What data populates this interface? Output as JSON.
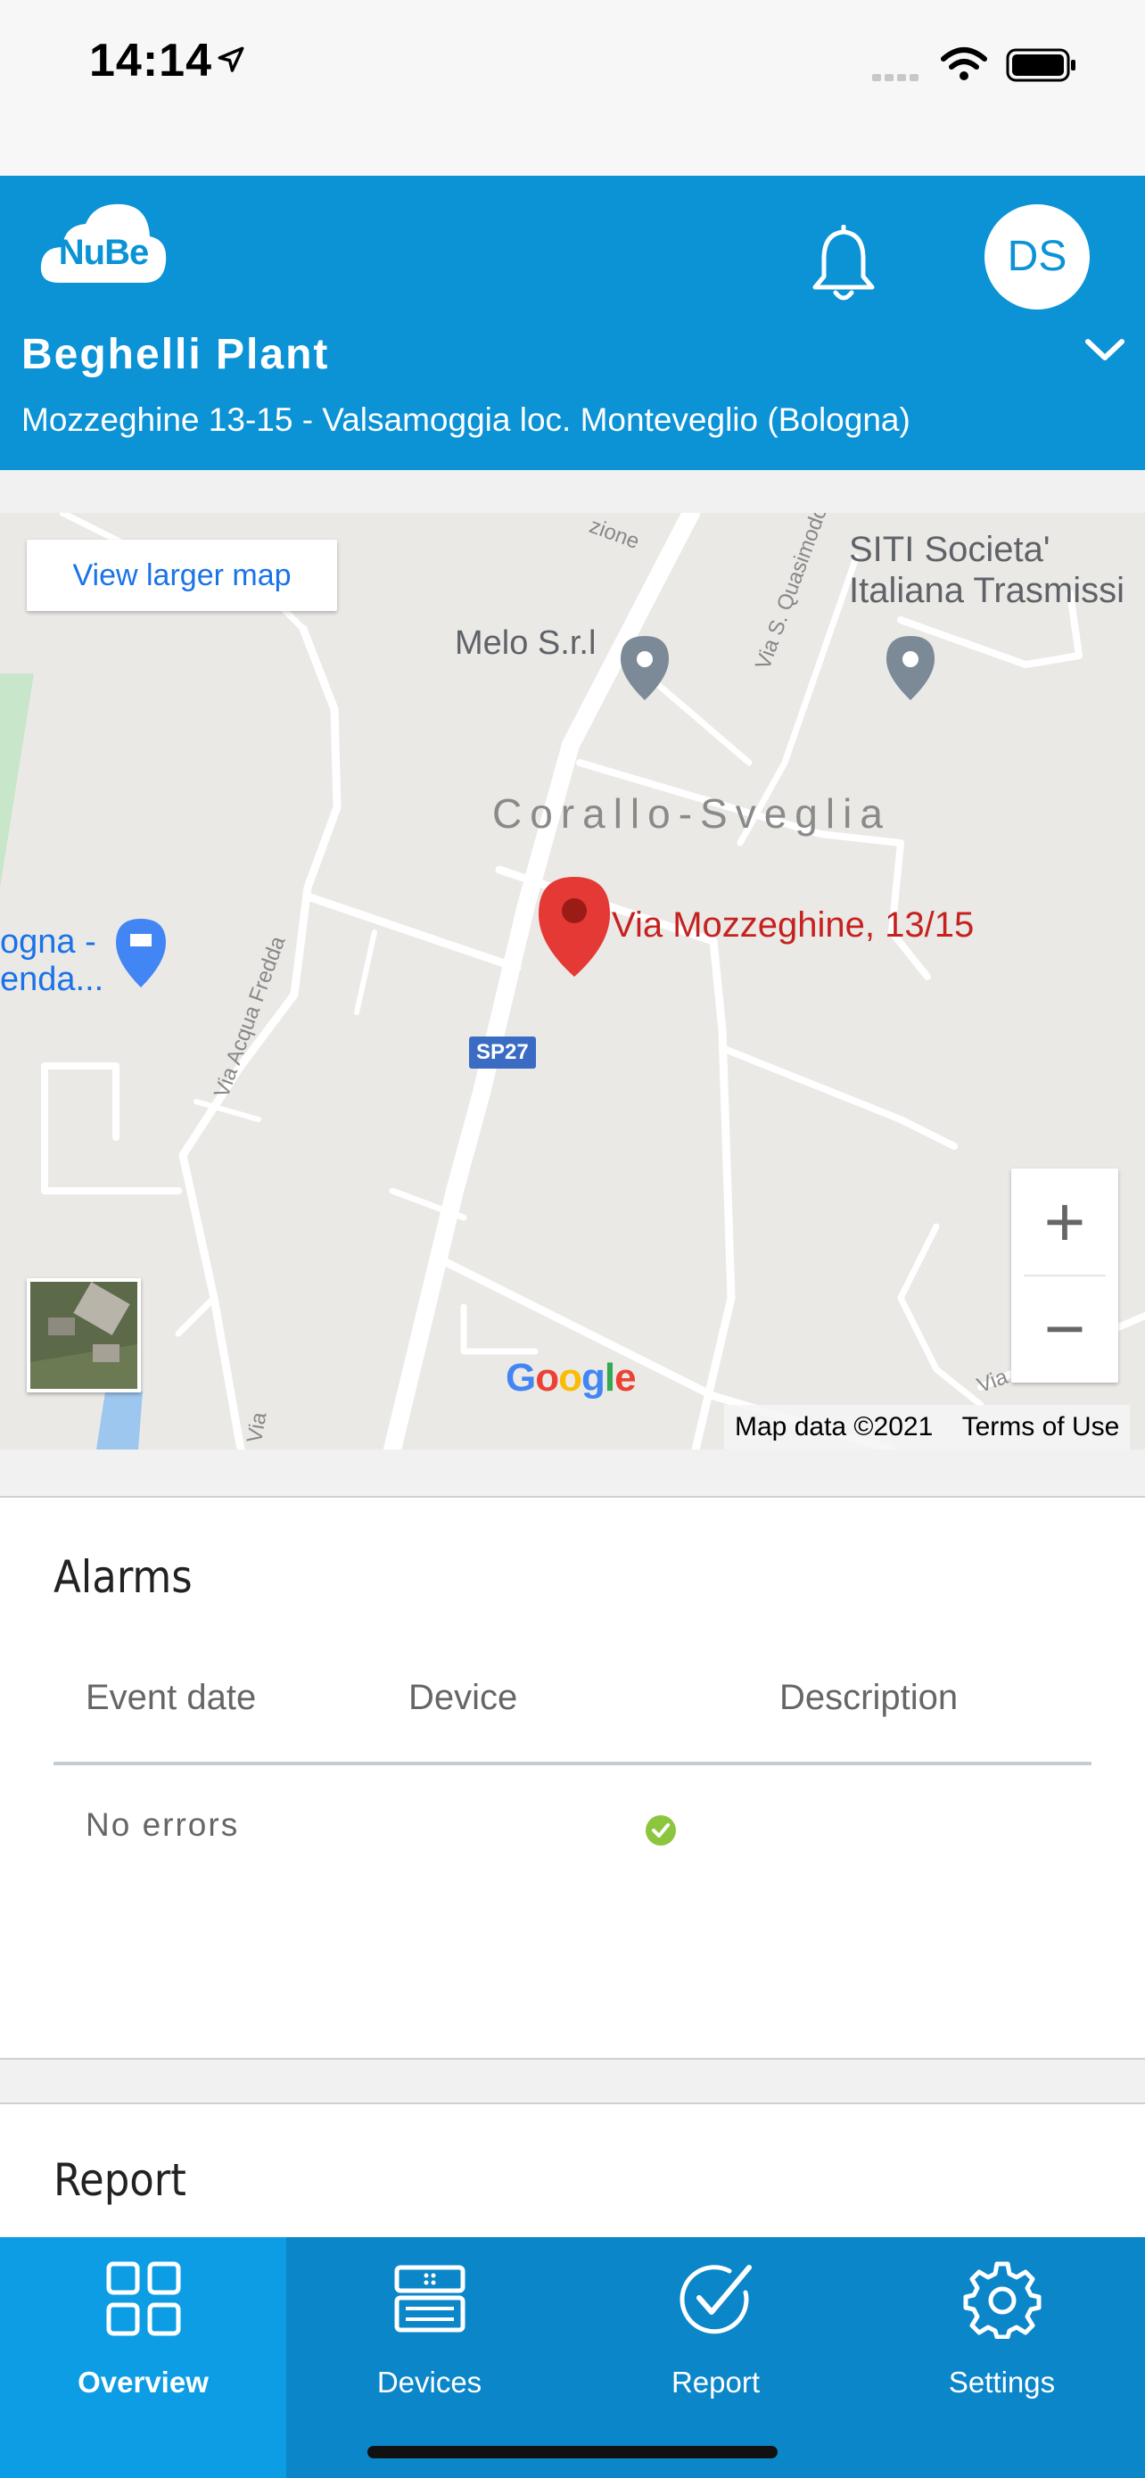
{
  "status_bar": {
    "time": "14:14"
  },
  "header": {
    "logo_text": "NuBe",
    "avatar_initials": "DS",
    "plant_name": "Beghelli Plant",
    "plant_address": "Mozzeghine 13-15 - Valsamoggia loc. Monteveglio (Bologna)"
  },
  "map": {
    "view_larger": "View larger map",
    "poi_melo": "Melo S.r.l",
    "poi_siti_line1": "SITI Societa'",
    "poi_siti_line2": "Italiana Trasmissi",
    "area_label": "Corallo-Sveglia",
    "pin_label": "Via Mozzeghine, 13/15",
    "shop_line1": "ogna -",
    "shop_line2": "enda...",
    "road_acqua": "Via Acqua Fredda",
    "road_quasimodo": "Via S. Quasimodo",
    "road_zione": "zione",
    "road_via_bottom": "Via",
    "road_via_right": "Via",
    "road_route": "SP27",
    "google": "Google",
    "map_data": "Map data ©2021",
    "terms": "Terms of Use",
    "zoom_in": "+",
    "zoom_out": "−"
  },
  "alarms": {
    "title": "Alarms",
    "columns": [
      "Event date",
      "Device",
      "Description"
    ],
    "empty_message": "No errors",
    "status_color": "#8cc63f"
  },
  "report": {
    "title": "Report"
  },
  "nav": {
    "items": [
      {
        "label": "Overview",
        "icon": "grid-icon",
        "active": true
      },
      {
        "label": "Devices",
        "icon": "devices-icon",
        "active": false
      },
      {
        "label": "Report",
        "icon": "check-circle-icon",
        "active": false
      },
      {
        "label": "Settings",
        "icon": "gear-icon",
        "active": false
      }
    ]
  },
  "colors": {
    "brand": "#0b93d6",
    "pin": "#e53935",
    "link": "#1a73e8"
  }
}
